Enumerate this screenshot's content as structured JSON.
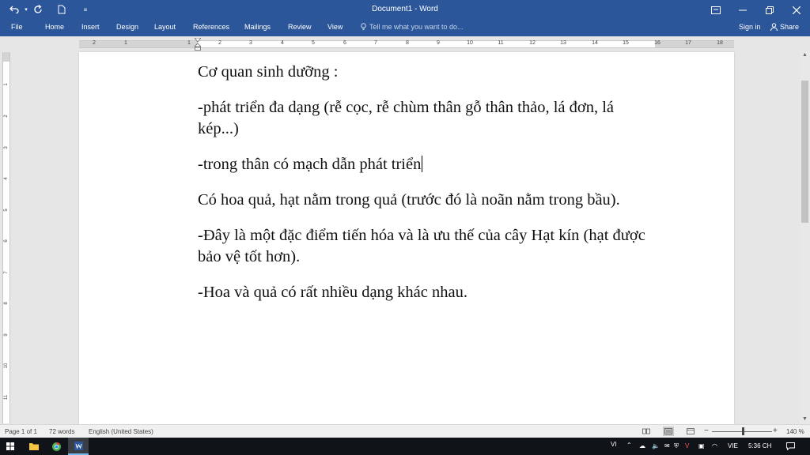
{
  "window": {
    "title": "Document1 - Word"
  },
  "quick_access": {
    "undo_icon": "undo-icon",
    "redo_icon": "redo-icon",
    "new_icon": "new-doc-icon",
    "customize_icon": "customize-qat-icon"
  },
  "ribbon": {
    "tabs": [
      "File",
      "Home",
      "Insert",
      "Design",
      "Layout",
      "References",
      "Mailings",
      "Review",
      "View"
    ],
    "tell_me_placeholder": "Tell me what you want to do...",
    "sign_in": "Sign in",
    "share": "Share"
  },
  "ruler": {
    "horizontal_numbers": [
      "2",
      "1",
      "1",
      "2",
      "3",
      "4",
      "5",
      "6",
      "7",
      "8",
      "9",
      "10",
      "11",
      "12",
      "13",
      "14",
      "15",
      "16",
      "17",
      "18"
    ],
    "vertical_numbers": [
      "1",
      "2",
      "3",
      "4",
      "5",
      "6",
      "7",
      "8",
      "9",
      "10",
      "11"
    ]
  },
  "document": {
    "paragraphs": [
      "Cơ quan sinh dưỡng :",
      "-phát triển đa dạng (rễ cọc, rễ chùm thân gỗ thân thảo, lá đơn, lá kép...)",
      "-trong thân có mạch dẫn phát triển",
      "Có hoa quả, hạt nằm trong quả (trước đó là noãn nằm trong bầu).",
      "-Đây là một đặc điểm tiến hóa và là ưu thế của cây Hạt kín (hạt được bảo vệ tốt hơn).",
      "-Hoa và quả có rất nhiều dạng khác nhau."
    ]
  },
  "status": {
    "page": "Page 1 of 1",
    "words": "72 words",
    "language": "English (United States)",
    "zoom": "140 %",
    "zoom_minus": "−",
    "zoom_plus": "+"
  },
  "taskbar": {
    "lang_short": "VI",
    "lang_full": "VIE",
    "time": "5:36 CH"
  },
  "colors": {
    "ribbon_blue": "#2b579a",
    "taskbar": "#101317"
  }
}
